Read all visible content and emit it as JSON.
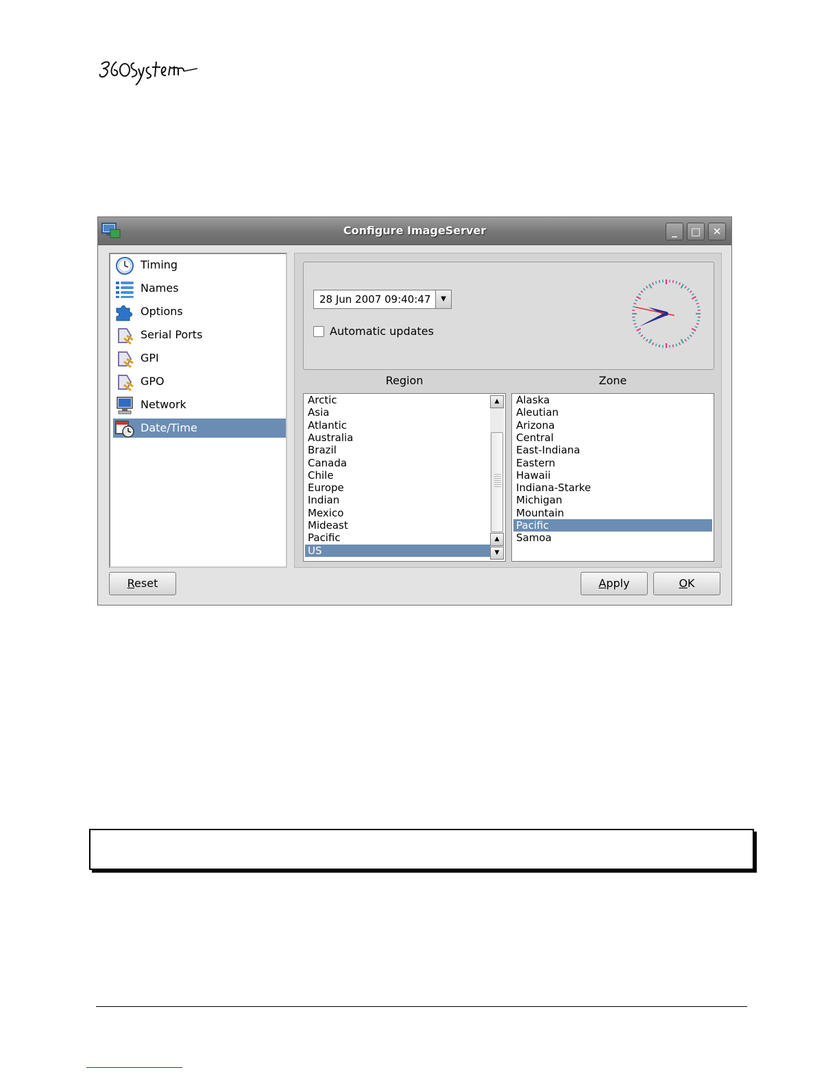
{
  "logo": {
    "alt_text": "360 Systems"
  },
  "window": {
    "title": "Configure ImageServer",
    "controls": {
      "minimize": "_",
      "maximize": "□",
      "close": "✕"
    }
  },
  "nav": {
    "items": [
      {
        "label": "Timing",
        "icon": "clock-icon"
      },
      {
        "label": "Names",
        "icon": "list-icon"
      },
      {
        "label": "Options",
        "icon": "puzzle-icon"
      },
      {
        "label": "Serial Ports",
        "icon": "connector-icon"
      },
      {
        "label": "GPI",
        "icon": "connector-icon"
      },
      {
        "label": "GPO",
        "icon": "connector-icon"
      },
      {
        "label": "Network",
        "icon": "monitor-icon"
      },
      {
        "label": "Date/Time",
        "icon": "calendar-clock-icon",
        "selected": true
      }
    ]
  },
  "datetime": {
    "value": "28 Jun 2007 09:40:47",
    "auto_updates_label": "Automatic updates",
    "auto_updates_checked": false,
    "clock": {
      "hour": 9,
      "minute": 40,
      "second": 47
    }
  },
  "region": {
    "title": "Region",
    "items": [
      "Arctic",
      "Asia",
      "Atlantic",
      "Australia",
      "Brazil",
      "Canada",
      "Chile",
      "Europe",
      "Indian",
      "Mexico",
      "Mideast",
      "Pacific",
      "US"
    ],
    "selected": "US"
  },
  "zone": {
    "title": "Zone",
    "items": [
      "Alaska",
      "Aleutian",
      "Arizona",
      "Central",
      "East-Indiana",
      "Eastern",
      "Hawaii",
      "Indiana-Starke",
      "Michigan",
      "Mountain",
      "Pacific",
      "Samoa"
    ],
    "selected": "Pacific"
  },
  "buttons": {
    "reset": {
      "mnemonic": "R",
      "rest": "eset"
    },
    "apply": {
      "mnemonic": "A",
      "rest": "pply"
    },
    "ok": {
      "mnemonic": "O",
      "rest": "K"
    }
  },
  "colors": {
    "selection": "#6b8db4",
    "clock_ticks": [
      "#d33a8c",
      "#35a39b"
    ],
    "second_hand": "#e0242b",
    "hour_minute_hands": "#2b2b8f"
  }
}
